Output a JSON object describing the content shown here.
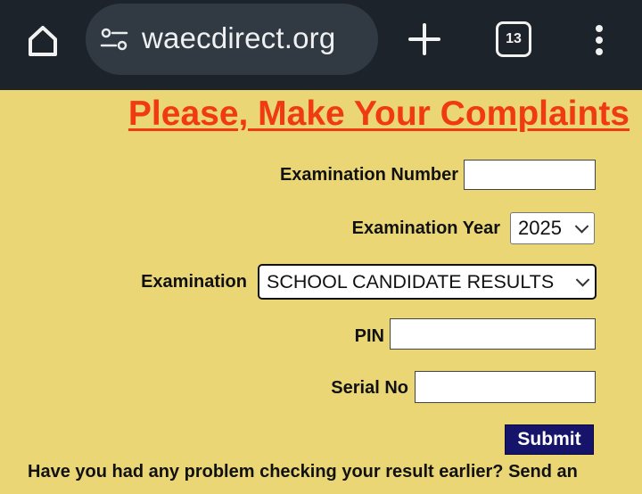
{
  "browser": {
    "url": "waecdirect.org",
    "tab_count": "13",
    "icons": {
      "home": "home-icon",
      "site_settings": "tune-icon",
      "new_tab": "plus-icon",
      "tabs": "tab-switcher-icon",
      "menu": "more-vert-icon"
    }
  },
  "page": {
    "headline": "Please, Make Your Complaints",
    "form": {
      "exam_number_label": "Examination Number",
      "exam_number_value": "",
      "exam_year_label": "Examination Year",
      "exam_year_selected": "2025",
      "exam_label": "Examination",
      "exam_selected": "SCHOOL CANDIDATE RESULTS",
      "pin_label": "PIN",
      "pin_value": "",
      "serial_label": "Serial No",
      "serial_value": "",
      "submit_label": "Submit"
    },
    "footer_text": "Have you had any problem checking your result earlier? Send an"
  },
  "colors": {
    "page_background": "#ead675",
    "headline": "#f03a12",
    "submit_background": "#16136b",
    "browser_bar": "#1d232a",
    "url_pill": "#313a43"
  }
}
